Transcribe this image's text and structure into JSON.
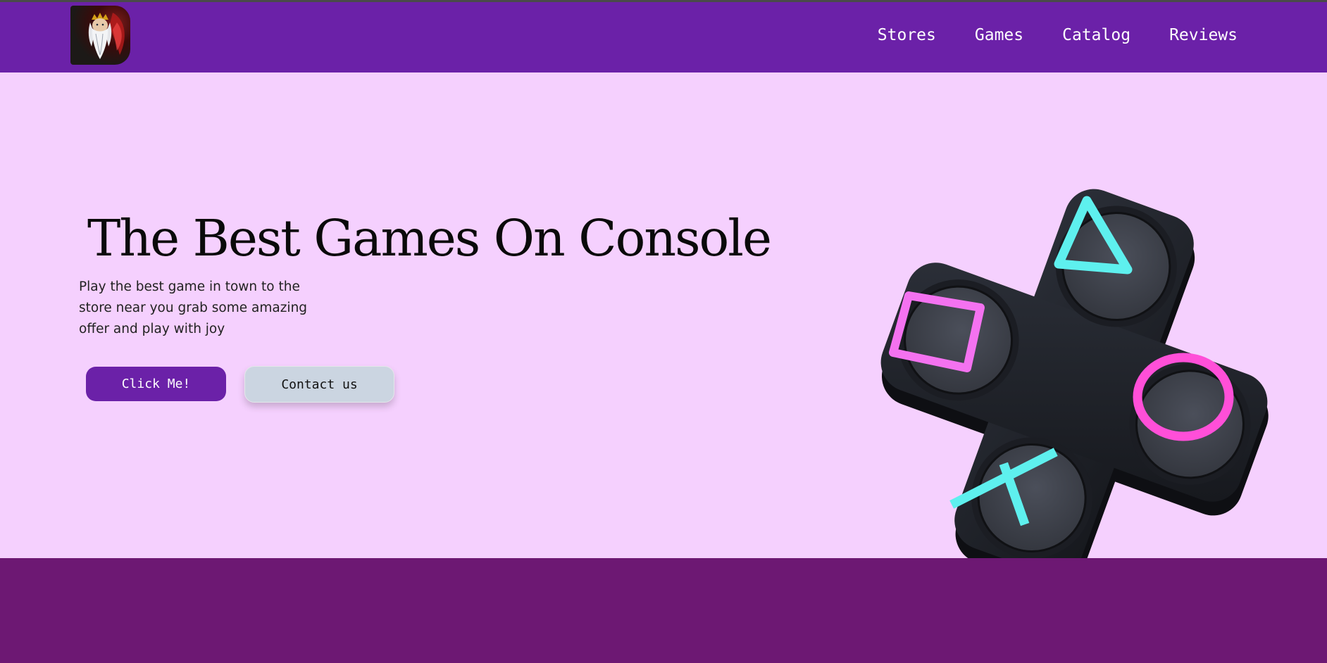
{
  "header": {
    "logo_icon": "bearded-wizard-avatar-icon",
    "nav": [
      {
        "label": "Stores"
      },
      {
        "label": "Games"
      },
      {
        "label": "Catalog"
      },
      {
        "label": "Reviews"
      }
    ]
  },
  "hero": {
    "title": "The Best Games On Console",
    "description": "Play the best game in town to the store near you grab some amazing offer and play with joy",
    "primary_button": "Click Me!",
    "secondary_button": "Contact us",
    "illustration_icon": "game-controller-buttons-icon"
  },
  "colors": {
    "header_bg": "#6b21a8",
    "hero_bg": "#f5d0fe",
    "footer_bg": "#6d1873",
    "primary_button_bg": "#6b21a8",
    "secondary_button_bg": "#cbd5e1",
    "accent_cyan": "#5ef0ee",
    "accent_pink": "#f472f0",
    "accent_magenta": "#ff4fd8"
  }
}
